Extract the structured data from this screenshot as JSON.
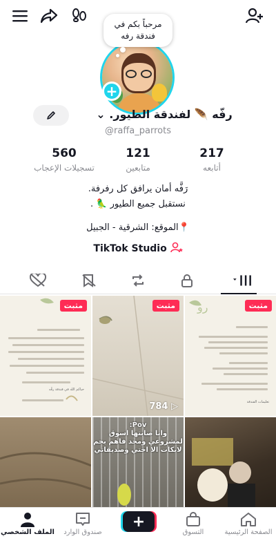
{
  "colors": {
    "accent_cyan": "#20d5ec",
    "accent_pink": "#fe2c55",
    "text": "#161823",
    "muted": "#8a8b91"
  },
  "topbar": {
    "icons": [
      "menu-icon",
      "share-icon",
      "footprints-icon",
      "add-friend-icon"
    ]
  },
  "profile": {
    "bubble_line1": "مرحباً بكم في",
    "bubble_line2": "فندقة رفه",
    "name": "رفّه 🪶 لفندقة الطيور.",
    "name_chevron": "⌄",
    "handle": "@raffa_parrots"
  },
  "stats": {
    "following": {
      "value": "217",
      "label": "أتابعه"
    },
    "followers": {
      "value": "121",
      "label": "متابعين"
    },
    "likes": {
      "value": "560",
      "label": "تسجيلات الإعجاب"
    }
  },
  "bio": {
    "line1": "رَفَّه أمان يرافق كل رفرفة.",
    "line2": "نستقبل جميع الطيور 🦜 .",
    "location": "📍الموقع: الشرقية - الجبيل",
    "studio": "TikTok Studio"
  },
  "tabs": [
    "videos-grid-icon",
    "lock-icon",
    "repost-icon",
    "saved-icon",
    "liked-icon"
  ],
  "videos": [
    {
      "pinned": "مثبت",
      "type": "text-card",
      "caption": "حياكم الله في فندقة رفّه"
    },
    {
      "pinned": "مثبت",
      "type": "video",
      "plays": "784"
    },
    {
      "pinned": "مثبت",
      "type": "text-card",
      "caption": "تعليمات الفندقة"
    },
    {
      "type": "video"
    },
    {
      "type": "video",
      "pov_title": "Pov:",
      "pov_text": "وانا صابتها اسوق لمشروعي ومحد فاهم بحم لايكات الا اختي وصديقاتي"
    },
    {
      "type": "video"
    }
  ],
  "nav": {
    "home": "الصفحة الرئيسية",
    "shop": "التسوق",
    "create": "+",
    "inbox": "صندوق الوارد",
    "profile": "الملف الشخصي"
  }
}
